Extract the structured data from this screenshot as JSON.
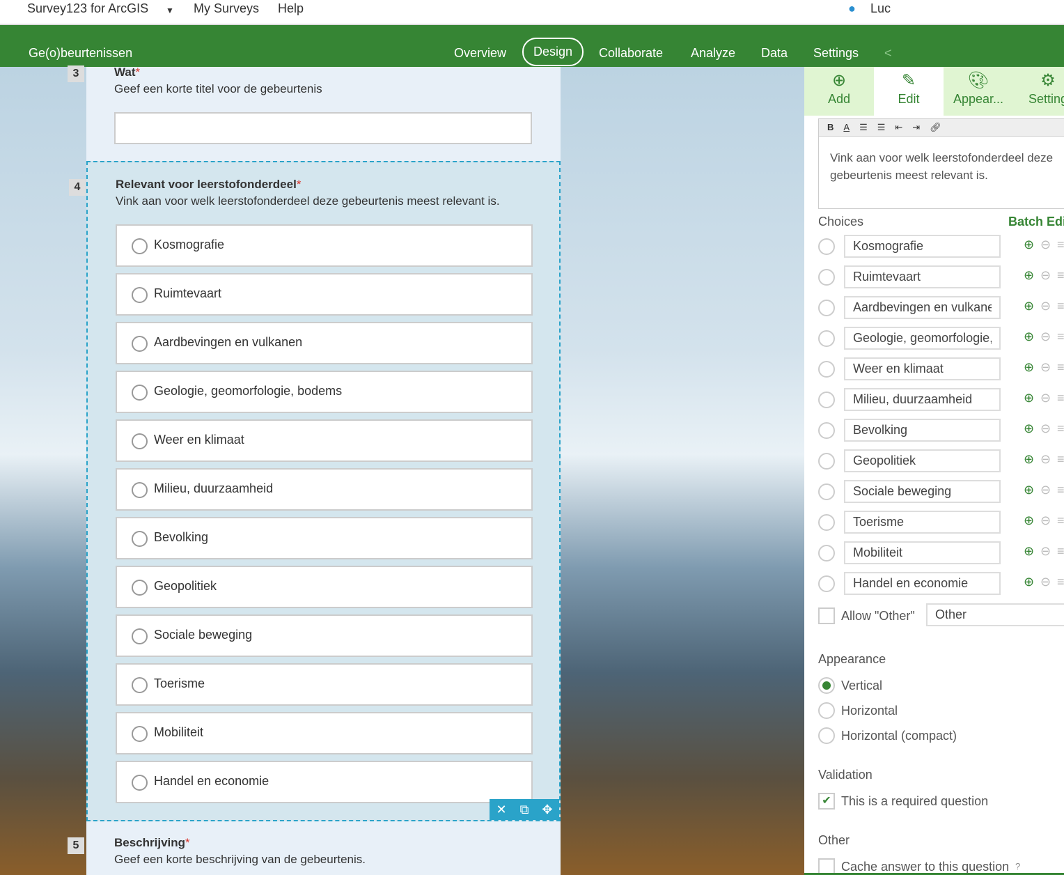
{
  "topbar": {
    "app": "Survey123 for ArcGIS",
    "my_surveys": "My Surveys",
    "help": "Help",
    "user": "Luc"
  },
  "header": {
    "survey_title": "Ge(o)beurtenissen",
    "nav": [
      "Overview",
      "Design",
      "Collaborate",
      "Analyze",
      "Data",
      "Settings"
    ],
    "active": "Design"
  },
  "form": {
    "q3": {
      "number": "3",
      "label": "Wat",
      "hint": "Geef een korte titel voor de gebeurtenis",
      "value": ""
    },
    "q4": {
      "number": "4",
      "label": "Relevant voor leerstofonderdeel",
      "hint": "Vink aan voor welk leerstofonderdeel deze gebeurtenis meest relevant is.",
      "choices": [
        "Kosmografie",
        "Ruimtevaart",
        "Aardbevingen en vulkanen",
        "Geologie, geomorfologie, bodems",
        "Weer en klimaat",
        "Milieu, duurzaamheid",
        "Bevolking",
        "Geopolitiek",
        "Sociale beweging",
        "Toerisme",
        "Mobiliteit",
        "Handel en economie"
      ]
    },
    "q5": {
      "number": "5",
      "label": "Beschrijving",
      "hint": "Geef een korte beschrijving van de gebeurtenis."
    },
    "required_mark": "*"
  },
  "panel": {
    "tabs": [
      {
        "label": "Add",
        "icon": "plus-circle-icon"
      },
      {
        "label": "Edit",
        "icon": "pencil-icon"
      },
      {
        "label": "Appear...",
        "icon": "palette-icon"
      },
      {
        "label": "Setting",
        "icon": "settings-icon"
      }
    ],
    "active_tab": "Edit",
    "hint_text": "Vink aan voor welk leerstofonderdeel deze gebeurtenis meest relevant is.",
    "choices_label": "Choices",
    "batch_edit": "Batch Edit",
    "choice_values": [
      "Kosmografie",
      "Ruimtevaart",
      "Aardbevingen en vulkanen",
      "Geologie, geomorfologie, bodems",
      "Weer en klimaat",
      "Milieu, duurzaamheid",
      "Bevolking",
      "Geopolitiek",
      "Sociale beweging",
      "Toerisme",
      "Mobiliteit",
      "Handel en economie"
    ],
    "allow_other": "Allow \"Other\"",
    "other_value": "Other",
    "appearance_label": "Appearance",
    "appearance_options": [
      "Vertical",
      "Horizontal",
      "Horizontal (compact)"
    ],
    "appearance_selected": "Vertical",
    "validation_label": "Validation",
    "required_label": "This is a required question",
    "required_checked": true,
    "other_label": "Other",
    "cache_label": "Cache answer to this question"
  },
  "colors": {
    "brand": "#368534",
    "selection": "#2aa3c9",
    "required": "#d9342b"
  }
}
